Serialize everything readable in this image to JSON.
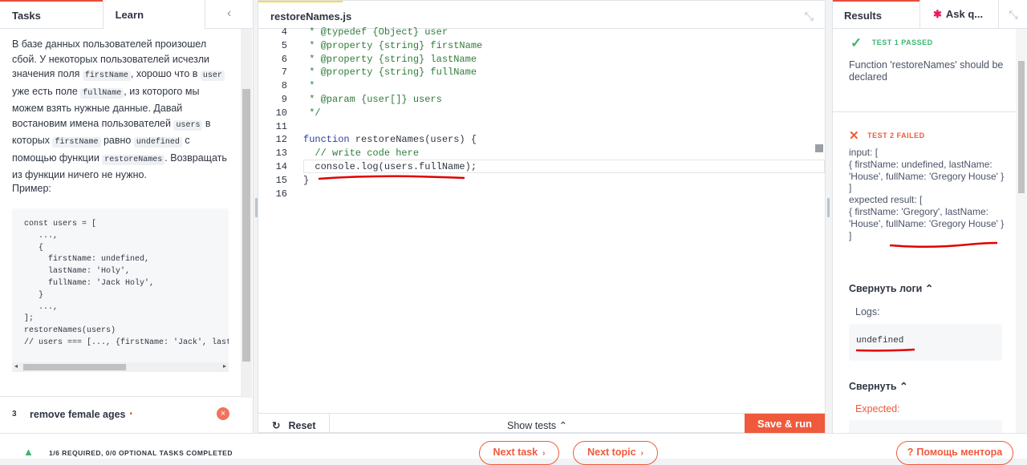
{
  "left": {
    "tabs": [
      "Tasks",
      "Learn"
    ],
    "collapse_icon": "chevron-left-icon",
    "description": [
      {
        "t": "text",
        "v": "В базе данных пользователей произошел сбой. У некоторых пользователей исчезли значения поля "
      },
      {
        "t": "code",
        "v": "firstName"
      },
      {
        "t": "text",
        "v": ", хорошо что в "
      },
      {
        "t": "code",
        "v": "user"
      },
      {
        "t": "text",
        "v": " уже есть поле "
      },
      {
        "t": "code",
        "v": "fullName"
      },
      {
        "t": "text",
        "v": ", из которого мы можем взять нужные данные. Давай востановим имена пользователей "
      },
      {
        "t": "code",
        "v": "users"
      },
      {
        "t": "text",
        "v": " в которых "
      },
      {
        "t": "code",
        "v": "firstName"
      },
      {
        "t": "text",
        "v": " равно "
      },
      {
        "t": "code",
        "v": "undefined"
      },
      {
        "t": "text",
        "v": " с помощью функции "
      },
      {
        "t": "code",
        "v": "restoreNames"
      },
      {
        "t": "text",
        "v": ". Возвращать из функции ничего не нужно."
      }
    ],
    "example_label": "Пример:",
    "example_code": "const users = [\n   ...,\n   {\n     firstName: undefined,\n     lastName: 'Holy',\n     fullName: 'Jack Holy',\n   }\n   ...,\n];\nrestoreNames(users)\n// users === [..., {firstName: 'Jack', lastName: 'Holy', fullName: 'Jack Holy'}, ...]",
    "task": {
      "number": "3",
      "name": "remove female ages",
      "status_icon": "close-icon"
    }
  },
  "editor": {
    "file_tab": "restoreNames.js",
    "expand_icon": "collapse-arrows-icon",
    "lines": [
      {
        "n": "4",
        "parts": [
          {
            "c": "cm",
            "v": " * @typedef {Object} user"
          }
        ]
      },
      {
        "n": "5",
        "parts": [
          {
            "c": "cm",
            "v": " * @property {string} firstName"
          }
        ]
      },
      {
        "n": "6",
        "parts": [
          {
            "c": "cm",
            "v": " * @property {string} lastName"
          }
        ]
      },
      {
        "n": "7",
        "parts": [
          {
            "c": "cm",
            "v": " * @property {string} fullName"
          }
        ]
      },
      {
        "n": "8",
        "parts": [
          {
            "c": "cm",
            "v": " *"
          }
        ]
      },
      {
        "n": "9",
        "parts": [
          {
            "c": "cm",
            "v": " * @param {user[]} users"
          }
        ]
      },
      {
        "n": "10",
        "parts": [
          {
            "c": "cm",
            "v": " */"
          }
        ]
      },
      {
        "n": "11",
        "parts": [
          {
            "c": "",
            "v": ""
          }
        ]
      },
      {
        "n": "12",
        "parts": [
          {
            "c": "kw",
            "v": "function"
          },
          {
            "c": "",
            "v": " restoreNames(users) {"
          }
        ]
      },
      {
        "n": "13",
        "parts": [
          {
            "c": "cm",
            "v": "  // write code here"
          }
        ]
      },
      {
        "n": "14",
        "parts": [
          {
            "c": "",
            "v": "  console.log(users.fullName);"
          }
        ]
      },
      {
        "n": "15",
        "parts": [
          {
            "c": "",
            "v": "}"
          }
        ]
      },
      {
        "n": "16",
        "parts": [
          {
            "c": "",
            "v": ""
          }
        ]
      }
    ],
    "reset_label": "Reset",
    "show_tests_label": "Show tests",
    "save_run_label": "Save & run"
  },
  "results": {
    "tabs": [
      "Results",
      "Ask q..."
    ],
    "test1": {
      "status": "TEST 1 PASSED",
      "text": "Function 'restoreNames' should be declared"
    },
    "test2": {
      "status": "TEST 2 FAILED",
      "text": "input: [\n{ firstName: undefined, lastName: 'House', fullName: 'Gregory House' }\n]\nexpected result: [\n{ firstName: 'Gregory', lastName: 'House', fullName: 'Gregory House' }\n]"
    },
    "collapse_logs": "Свернуть логи",
    "logs_label": "Logs:",
    "log_value": "undefined",
    "collapse": "Свернуть",
    "expected_label": "Expected:"
  },
  "bottom": {
    "progress_text": "1/6 REQUIRED, 0/0 OPTIONAL TASKS COMPLETED",
    "next_task": "Next task",
    "next_topic": "Next topic",
    "mentor_help": "Помощь ментора"
  },
  "colors": {
    "accent": "#ef5a3c",
    "pass": "#3cb371",
    "annotation": "#e00000"
  }
}
